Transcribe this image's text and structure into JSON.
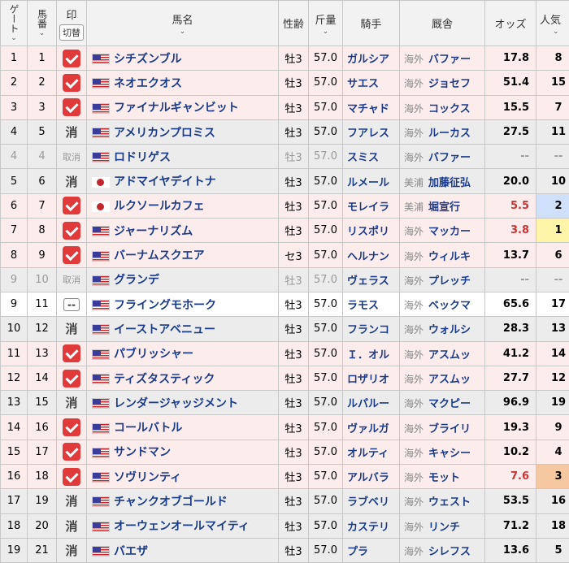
{
  "headers": {
    "gate": "ゲート",
    "number": "馬番",
    "mark": "印",
    "switch_label": "切替",
    "name": "馬名",
    "sex_age": "性齢",
    "weight": "斤量",
    "jockey": "騎手",
    "trainer": "厩舎",
    "odds": "オッズ",
    "popularity": "人気",
    "sort_icon": "⌄"
  },
  "rows": [
    {
      "gate": "1",
      "num": "1",
      "mark": "check",
      "flag": "us",
      "name": "シチズンブル",
      "sex": "牡3",
      "weight": "57.0",
      "jockey": "ガルシア",
      "region": "海外",
      "trainer": "バファー",
      "odds": "17.8",
      "pop": "8",
      "row": "pink",
      "odds_style": "",
      "pop_style": ""
    },
    {
      "gate": "2",
      "num": "2",
      "mark": "check",
      "flag": "us",
      "name": "ネオエクオス",
      "sex": "牡3",
      "weight": "57.0",
      "jockey": "サエス",
      "region": "海外",
      "trainer": "ジョセフ",
      "odds": "51.4",
      "pop": "15",
      "row": "pink",
      "odds_style": "",
      "pop_style": ""
    },
    {
      "gate": "3",
      "num": "3",
      "mark": "check",
      "flag": "us",
      "name": "ファイナルギャンビット",
      "sex": "牡3",
      "weight": "57.0",
      "jockey": "マチャド",
      "region": "海外",
      "trainer": "コックス",
      "odds": "15.5",
      "pop": "7",
      "row": "pink",
      "odds_style": "",
      "pop_style": ""
    },
    {
      "gate": "4",
      "num": "5",
      "mark": "消",
      "flag": "us",
      "name": "アメリカンプロミス",
      "sex": "牡3",
      "weight": "57.0",
      "jockey": "フアレス",
      "region": "海外",
      "trainer": "ルーカス",
      "odds": "27.5",
      "pop": "11",
      "row": "gray",
      "odds_style": "",
      "pop_style": ""
    },
    {
      "gate": "4",
      "num": "4",
      "mark": "取消",
      "flag": "us",
      "name": "ロドリゲス",
      "sex": "牡3",
      "weight": "57.0",
      "jockey": "スミス",
      "region": "海外",
      "trainer": "バファー",
      "odds": "--",
      "pop": "--",
      "row": "gray scratched",
      "odds_style": "dash",
      "pop_style": ""
    },
    {
      "gate": "5",
      "num": "6",
      "mark": "消",
      "flag": "jp",
      "name": "アドマイヤデイトナ",
      "sex": "牡3",
      "weight": "57.0",
      "jockey": "ルメール",
      "region": "美浦",
      "trainer": "加藤征弘",
      "odds": "20.0",
      "pop": "10",
      "row": "gray",
      "odds_style": "",
      "pop_style": ""
    },
    {
      "gate": "6",
      "num": "7",
      "mark": "check",
      "flag": "jp",
      "name": "ルクソールカフェ",
      "sex": "牡3",
      "weight": "57.0",
      "jockey": "モレイラ",
      "region": "美浦",
      "trainer": "堀宣行",
      "odds": "5.5",
      "pop": "2",
      "row": "pink",
      "odds_style": "red",
      "pop_style": "pop2"
    },
    {
      "gate": "7",
      "num": "8",
      "mark": "check",
      "flag": "us",
      "name": "ジャーナリズム",
      "sex": "牡3",
      "weight": "57.0",
      "jockey": "リスポリ",
      "region": "海外",
      "trainer": "マッカー",
      "odds": "3.8",
      "pop": "1",
      "row": "pink",
      "odds_style": "red",
      "pop_style": "pop1"
    },
    {
      "gate": "8",
      "num": "9",
      "mark": "check",
      "flag": "us",
      "name": "バーナムスクエア",
      "sex": "セ3",
      "weight": "57.0",
      "jockey": "ヘルナン",
      "region": "海外",
      "trainer": "ウィルキ",
      "odds": "13.7",
      "pop": "6",
      "row": "pink",
      "odds_style": "",
      "pop_style": ""
    },
    {
      "gate": "9",
      "num": "10",
      "mark": "取消",
      "flag": "us",
      "name": "グランデ",
      "sex": "牡3",
      "weight": "57.0",
      "jockey": "ヴェラス",
      "region": "海外",
      "trainer": "プレッチ",
      "odds": "--",
      "pop": "--",
      "row": "gray scratched",
      "odds_style": "dash",
      "pop_style": ""
    },
    {
      "gate": "9",
      "num": "11",
      "mark": "--",
      "flag": "us",
      "name": "フライングモホーク",
      "sex": "牡3",
      "weight": "57.0",
      "jockey": "ラモス",
      "region": "海外",
      "trainer": "ベックマ",
      "odds": "65.6",
      "pop": "17",
      "row": "white",
      "odds_style": "",
      "pop_style": ""
    },
    {
      "gate": "10",
      "num": "12",
      "mark": "消",
      "flag": "us",
      "name": "イーストアベニュー",
      "sex": "牡3",
      "weight": "57.0",
      "jockey": "フランコ",
      "region": "海外",
      "trainer": "ウォルシ",
      "odds": "28.3",
      "pop": "13",
      "row": "gray",
      "odds_style": "",
      "pop_style": ""
    },
    {
      "gate": "11",
      "num": "13",
      "mark": "check",
      "flag": "us",
      "name": "パブリッシャー",
      "sex": "牡3",
      "weight": "57.0",
      "jockey": "Ｉ．オル",
      "region": "海外",
      "trainer": "アスムッ",
      "odds": "41.2",
      "pop": "14",
      "row": "pink",
      "odds_style": "",
      "pop_style": ""
    },
    {
      "gate": "12",
      "num": "14",
      "mark": "check",
      "flag": "us",
      "name": "ティズタスティック",
      "sex": "牡3",
      "weight": "57.0",
      "jockey": "ロザリオ",
      "region": "海外",
      "trainer": "アスムッ",
      "odds": "27.7",
      "pop": "12",
      "row": "pink",
      "odds_style": "",
      "pop_style": ""
    },
    {
      "gate": "13",
      "num": "15",
      "mark": "消",
      "flag": "us",
      "name": "レンダージャッジメント",
      "sex": "牡3",
      "weight": "57.0",
      "jockey": "ルパルー",
      "region": "海外",
      "trainer": "マクピー",
      "odds": "96.9",
      "pop": "19",
      "row": "gray",
      "odds_style": "",
      "pop_style": ""
    },
    {
      "gate": "14",
      "num": "16",
      "mark": "check",
      "flag": "us",
      "name": "コールバトル",
      "sex": "牡3",
      "weight": "57.0",
      "jockey": "ヴァルガ",
      "region": "海外",
      "trainer": "ブライリ",
      "odds": "19.3",
      "pop": "9",
      "row": "pink",
      "odds_style": "",
      "pop_style": ""
    },
    {
      "gate": "15",
      "num": "17",
      "mark": "check",
      "flag": "us",
      "name": "サンドマン",
      "sex": "牡3",
      "weight": "57.0",
      "jockey": "オルティ",
      "region": "海外",
      "trainer": "キャシー",
      "odds": "10.2",
      "pop": "4",
      "row": "pink",
      "odds_style": "",
      "pop_style": ""
    },
    {
      "gate": "16",
      "num": "18",
      "mark": "check",
      "flag": "us",
      "name": "ソヴリンティ",
      "sex": "牡3",
      "weight": "57.0",
      "jockey": "アルバラ",
      "region": "海外",
      "trainer": "モット",
      "odds": "7.6",
      "pop": "3",
      "row": "pink",
      "odds_style": "red",
      "pop_style": "pop3"
    },
    {
      "gate": "17",
      "num": "19",
      "mark": "消",
      "flag": "us",
      "name": "チャンクオブゴールド",
      "sex": "牡3",
      "weight": "57.0",
      "jockey": "ラブベリ",
      "region": "海外",
      "trainer": "ウェスト",
      "odds": "53.5",
      "pop": "16",
      "row": "gray",
      "odds_style": "",
      "pop_style": ""
    },
    {
      "gate": "18",
      "num": "20",
      "mark": "消",
      "flag": "us",
      "name": "オーウェンオールマイティ",
      "sex": "牡3",
      "weight": "57.0",
      "jockey": "カステリ",
      "region": "海外",
      "trainer": "リンチ",
      "odds": "71.2",
      "pop": "18",
      "row": "gray",
      "odds_style": "",
      "pop_style": ""
    },
    {
      "gate": "19",
      "num": "21",
      "mark": "消",
      "flag": "us",
      "name": "バエザ",
      "sex": "牡3",
      "weight": "57.0",
      "jockey": "プラ",
      "region": "海外",
      "trainer": "シレフス",
      "odds": "13.6",
      "pop": "5",
      "row": "gray",
      "odds_style": "",
      "pop_style": ""
    }
  ]
}
